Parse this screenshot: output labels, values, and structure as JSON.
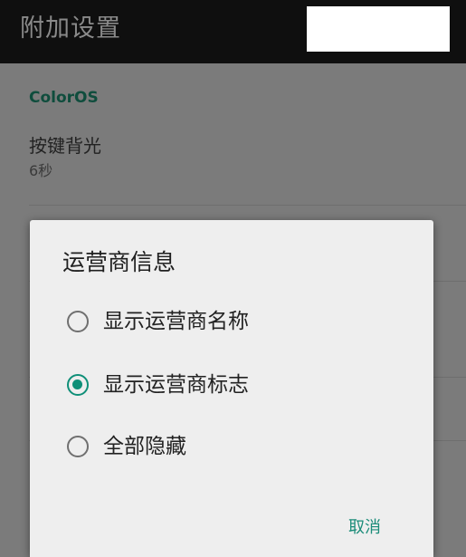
{
  "app_bar": {
    "title": "附加设置"
  },
  "settings": {
    "section_header": "ColorOS",
    "items": [
      {
        "title": "按键背光",
        "value": "6秒"
      }
    ]
  },
  "dialog": {
    "title": "运营商信息",
    "options": [
      {
        "label": "显示运营商名称",
        "selected": false
      },
      {
        "label": "显示运营商标志",
        "selected": true
      },
      {
        "label": "全部隐藏",
        "selected": false
      }
    ],
    "cancel_label": "取消"
  },
  "colors": {
    "accent": "#0f8f78",
    "app_bar_bg": "#0f0f0f",
    "dialog_bg": "#eeeeee",
    "section_header": "#0f4d3d"
  },
  "icons": {
    "radio_unchecked": "radio-unchecked-icon",
    "radio_checked": "radio-checked-icon"
  }
}
